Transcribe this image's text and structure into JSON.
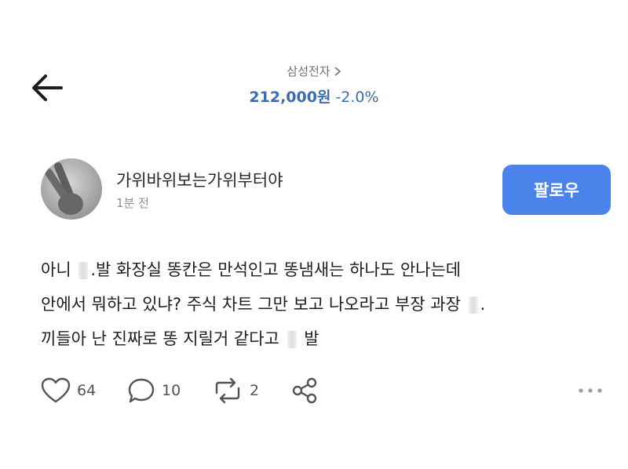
{
  "header": {
    "stock_name": "삼성전자",
    "stock_price": "212,000원",
    "stock_change": "-2.0%"
  },
  "post": {
    "username": "가위바위보는가위부터야",
    "time": "1분 전",
    "follow_label": "팔로우",
    "lines": [
      [
        "아니 ",
        ".발 화장실 똥칸은 만석인고 똥냄새는 하나도 안나는데"
      ],
      [
        "안에서 뭐하고 있냐? 주식 차트 그만 보고 나오라고 부장 과장 ",
        "."
      ],
      [
        "끼들아 난 진짜로 똥 지릴거 같다고 ",
        " 발"
      ]
    ]
  },
  "actions": {
    "likes": "64",
    "comments": "10",
    "reposts": "2"
  },
  "icons": [
    "back-arrow-icon",
    "chevron-right-icon",
    "heart-icon",
    "comment-icon",
    "repost-icon",
    "share-icon",
    "more-icon"
  ],
  "colors": {
    "accent": "#4a84ea",
    "price": "#3b6db0"
  }
}
